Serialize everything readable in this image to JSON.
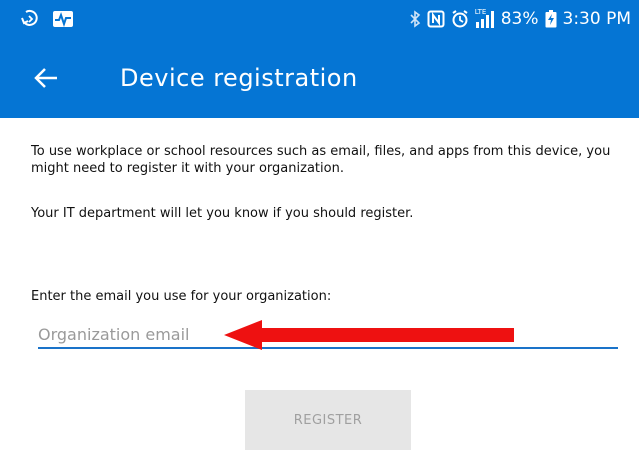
{
  "status_bar": {
    "battery": "83%",
    "time": "3:30 PM",
    "network_label": "LTE",
    "icons": [
      "hangouts-icon",
      "pulse-icon",
      "bluetooth-icon",
      "nfc-icon",
      "alarm-icon",
      "signal-icon",
      "battery-icon"
    ]
  },
  "app_bar": {
    "back_icon": "arrow-back-icon",
    "title": "Device registration",
    "color": "#0575d4"
  },
  "content": {
    "intro": "To use workplace or school resources such as email, files, and apps from this device, you might need to register it with your organization.",
    "it_note": "Your IT department will let you know if you should register.",
    "email_label": "Enter the email you use for your organization:",
    "email_placeholder": "Organization email",
    "email_value": "",
    "annotation": "red-arrow-icon",
    "register_label": "REGISTER"
  }
}
